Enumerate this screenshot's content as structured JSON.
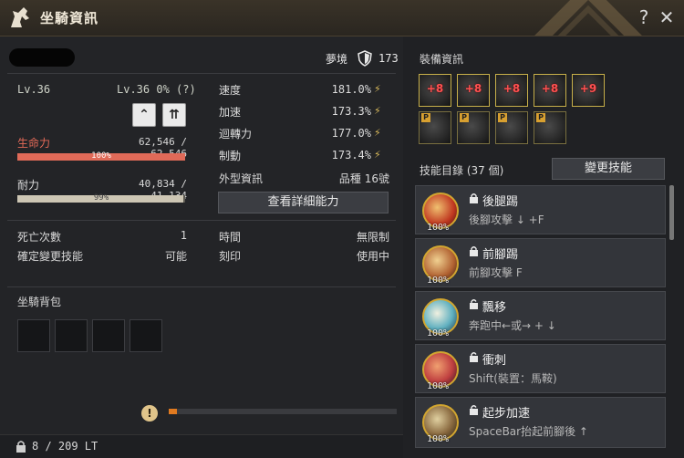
{
  "window": {
    "title": "坐騎資訊",
    "help_label": "?",
    "close_label": "✕"
  },
  "header": {
    "dream_label": "夢境",
    "dream_value": "173"
  },
  "level": {
    "left": "Lv.36",
    "right": "Lv.36 0% (?)"
  },
  "hp": {
    "label": "生命力",
    "value": "62,546 / 62,546",
    "bar_text": "100%",
    "fill": 1.0
  },
  "stamina": {
    "label": "耐力",
    "value": "40,834 / 41,134",
    "bar_text": "99%",
    "fill": 0.99
  },
  "stats": [
    {
      "label": "速度",
      "value": "181.0%"
    },
    {
      "label": "加速",
      "value": "173.3%"
    },
    {
      "label": "迴轉力",
      "value": "177.0%"
    },
    {
      "label": "制動",
      "value": "173.4%"
    }
  ],
  "appearance": {
    "label": "外型資訊",
    "value": "品種 16號"
  },
  "detail_button": "查看詳細能力",
  "info": {
    "deaths_label": "死亡次數",
    "deaths_value": "1",
    "time_label": "時間",
    "time_value": "無限制",
    "skill_change_label": "確定變更技能",
    "skill_change_value": "可能",
    "imprint_label": "刻印",
    "imprint_value": "使用中"
  },
  "bag": {
    "title": "坐騎背包",
    "weight": "8 / 209 LT",
    "warn": "!"
  },
  "equipment": {
    "title": "裝備資訊",
    "top_row": [
      "+8",
      "+8",
      "+8",
      "+8",
      "+9"
    ],
    "bottom_row": [
      "P",
      "P",
      "P",
      "P",
      "P"
    ]
  },
  "skills": {
    "title": "技能目錄 (37 個)",
    "change_button": "變更技能",
    "items": [
      {
        "name": "後腿踢",
        "key": "後腳攻擊 ↓ +F",
        "pct": "100%",
        "locked": true
      },
      {
        "name": "前腳踢",
        "key": "前腳攻擊 F",
        "pct": "100%",
        "locked": true
      },
      {
        "name": "飄移",
        "key": "奔跑中←或→ + ↓",
        "pct": "100%",
        "locked": false
      },
      {
        "name": "衝刺",
        "key": "Shift(裝置：馬鞍)",
        "pct": "100%",
        "locked": false
      },
      {
        "name": "起步加速",
        "key": "SpaceBar抬起前腳後 ↑",
        "pct": "100%",
        "locked": false
      }
    ]
  },
  "colors": {
    "hp": "#e06a58",
    "stamina": "#cdc6b4",
    "accent": "#d2a630",
    "progress": "#e07a20"
  }
}
